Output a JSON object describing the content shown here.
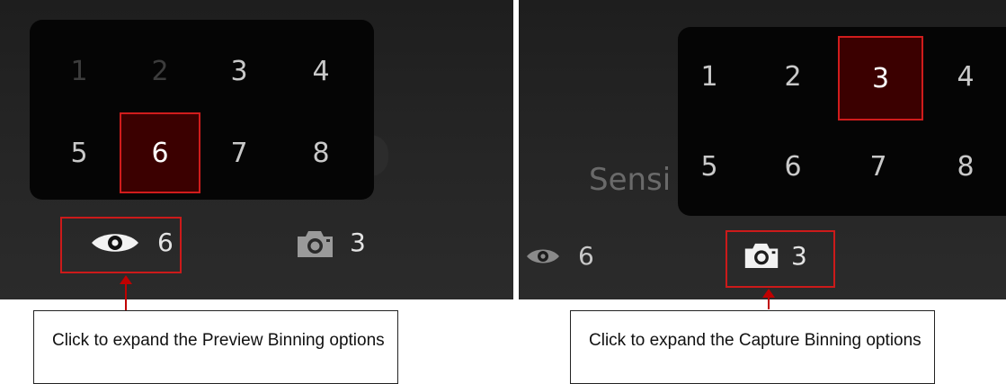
{
  "preview_panel": {
    "grid": [
      {
        "label": "1",
        "state": "disabled"
      },
      {
        "label": "2",
        "state": "disabled"
      },
      {
        "label": "3",
        "state": "normal"
      },
      {
        "label": "4",
        "state": "normal"
      },
      {
        "label": "5",
        "state": "normal"
      },
      {
        "label": "6",
        "state": "selected"
      },
      {
        "label": "7",
        "state": "normal"
      },
      {
        "label": "8",
        "state": "normal"
      }
    ],
    "preview_binning_value": "6",
    "capture_binning_value": "3"
  },
  "capture_panel": {
    "grid": [
      {
        "label": "1",
        "state": "normal"
      },
      {
        "label": "2",
        "state": "normal"
      },
      {
        "label": "3",
        "state": "selected"
      },
      {
        "label": "4",
        "state": "normal"
      },
      {
        "label": "5",
        "state": "normal"
      },
      {
        "label": "6",
        "state": "normal"
      },
      {
        "label": "7",
        "state": "normal"
      },
      {
        "label": "8",
        "state": "normal"
      }
    ],
    "background_label": "Sensi",
    "preview_binning_value": "6",
    "capture_binning_value": "3"
  },
  "callouts": {
    "preview": "Click to expand the Preview Binning options",
    "capture": "Click to expand the Capture Binning options"
  },
  "icons": {
    "preview": "eye-icon",
    "capture": "camera-icon"
  },
  "colors": {
    "selected_fill": "#3b0000",
    "highlight": "#d01c1c",
    "arrow": "#c00000"
  }
}
